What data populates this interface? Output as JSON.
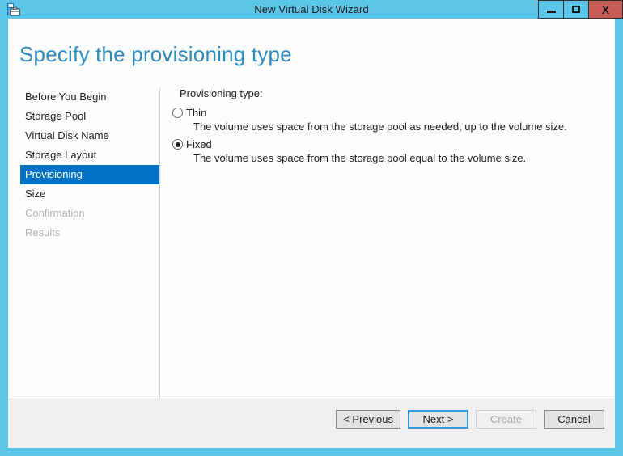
{
  "window": {
    "title": "New Virtual Disk Wizard",
    "icon": "virtual-disk-wizard-icon",
    "controls": {
      "minimize": "–",
      "maximize": "□",
      "close": "X"
    },
    "colors": {
      "frame": "#5bc6e8",
      "close_button": "#c75b56",
      "accent": "#0072c6",
      "heading": "#2e8bc0",
      "focus_border": "#3399e0"
    }
  },
  "page": {
    "heading": "Specify the provisioning type"
  },
  "sidebar": {
    "items": [
      {
        "label": "Before You Begin",
        "state": "normal"
      },
      {
        "label": "Storage Pool",
        "state": "normal"
      },
      {
        "label": "Virtual Disk Name",
        "state": "normal"
      },
      {
        "label": "Storage Layout",
        "state": "normal"
      },
      {
        "label": "Provisioning",
        "state": "active"
      },
      {
        "label": "Size",
        "state": "normal"
      },
      {
        "label": "Confirmation",
        "state": "disabled"
      },
      {
        "label": "Results",
        "state": "disabled"
      }
    ]
  },
  "main": {
    "field_label": "Provisioning type:",
    "options": [
      {
        "label": "Thin",
        "selected": false,
        "description": "The volume uses space from the storage pool as needed, up to the volume size."
      },
      {
        "label": "Fixed",
        "selected": true,
        "description": "The volume uses space from the storage pool equal to the volume size."
      }
    ]
  },
  "footer": {
    "buttons": [
      {
        "label": "< Previous",
        "state": "normal"
      },
      {
        "label": "Next >",
        "state": "focused"
      },
      {
        "label": "Create",
        "state": "disabled"
      },
      {
        "label": "Cancel",
        "state": "normal"
      }
    ]
  }
}
